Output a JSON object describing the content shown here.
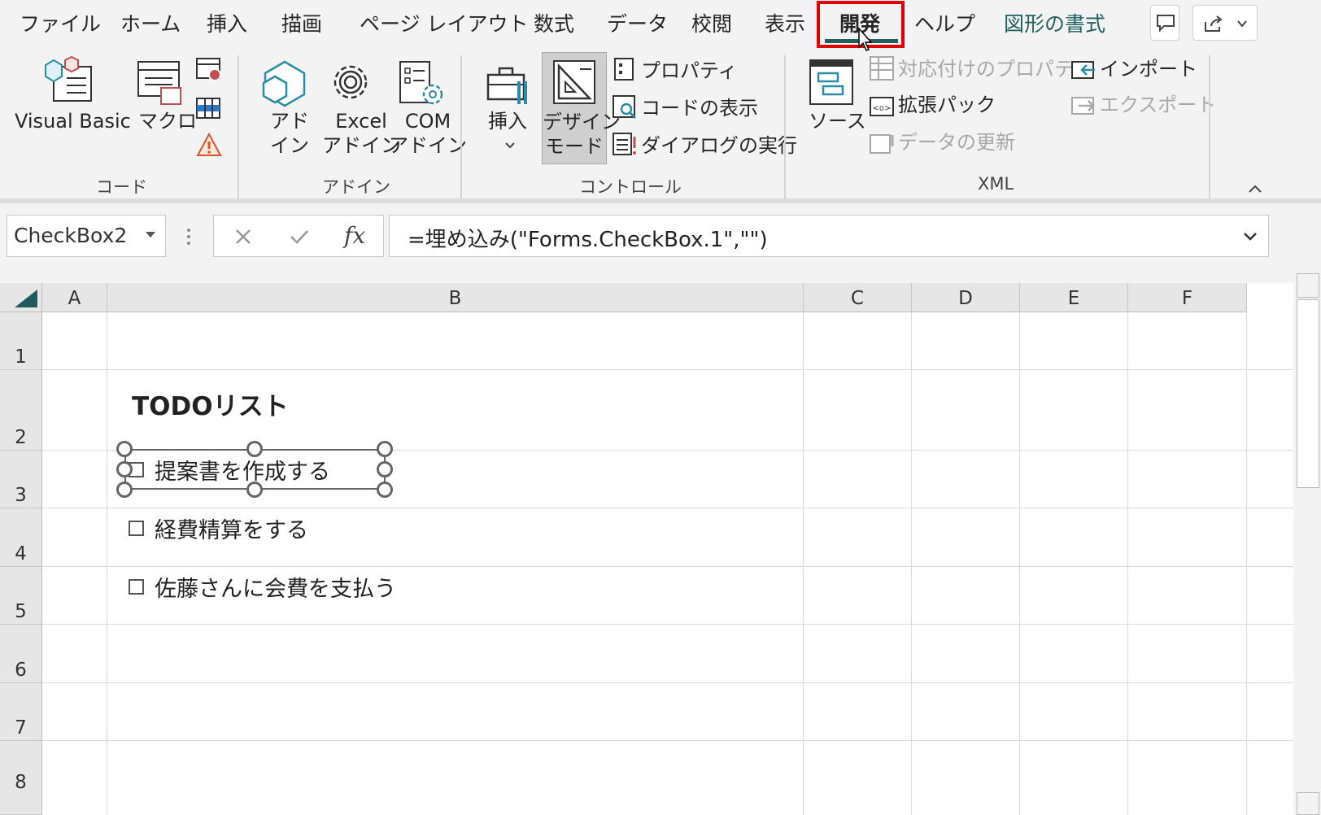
{
  "tabs": [
    "ファイル",
    "ホーム",
    "挿入",
    "描画",
    "ページ レイアウト",
    "数式",
    "データ",
    "校閲",
    "表示",
    "開発",
    "ヘルプ",
    "図形の書式"
  ],
  "ribbon": {
    "code": {
      "group": "コード",
      "visual_basic": "Visual Basic",
      "macro": "マクロ"
    },
    "addins": {
      "group": "アドイン",
      "addin_1": "アド",
      "addin_2": "イン",
      "excel_1": "Excel",
      "excel_2": "アドイン",
      "com_1": "COM",
      "com_2": "アドイン"
    },
    "controls": {
      "group": "コントロール",
      "insert": "挿入",
      "design_1": "デザイン",
      "design_2": "モード",
      "properties": "プロパティ",
      "view_code": "コードの表示",
      "run_dialog": "ダイアログの実行"
    },
    "xml": {
      "group": "XML",
      "source": "ソース",
      "map_properties": "対応付けのプロパティ",
      "expansion_packs": "拡張パック",
      "refresh_data": "データの更新",
      "import": "インポート",
      "export": "エクスポート"
    }
  },
  "formula_bar": {
    "name_box": "CheckBox2",
    "fx": "fx",
    "formula": "=埋め込み(\"Forms.CheckBox.1\",\"\")"
  },
  "sheet": {
    "columns": [
      "A",
      "B",
      "C",
      "D",
      "E",
      "F"
    ],
    "rows": [
      "1",
      "2",
      "3",
      "4",
      "5",
      "6",
      "7",
      "8"
    ],
    "title": "TODOリスト",
    "checkboxes": [
      "提案書を作成する",
      "経費精算をする",
      "佐藤さんに会費を支払う"
    ]
  }
}
